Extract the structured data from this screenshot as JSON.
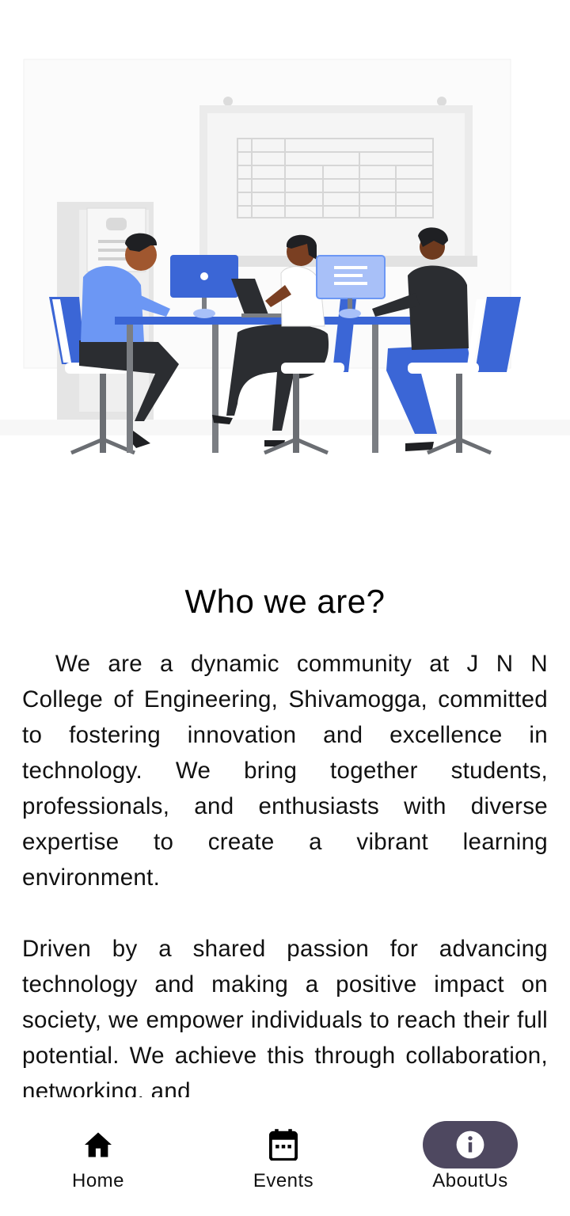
{
  "about": {
    "title": "Who we are?",
    "paragraph_1": "We are a dynamic community at J N N College of Engineering, Shivamogga, committed to fostering innovation and excellence in technology. We bring together students, professionals, and enthusiasts with diverse expertise to create a vibrant learning environment.",
    "paragraph_2": "Driven by a shared passion for advancing technology and making a positive impact on society, we empower individuals to reach their full potential. We achieve this through collaboration, networking, and"
  },
  "nav": {
    "items": [
      {
        "label": "Home",
        "icon": "home-icon"
      },
      {
        "label": "Events",
        "icon": "calendar-icon"
      },
      {
        "label": "AboutUs",
        "icon": "info-icon"
      }
    ],
    "active": "AboutUs"
  },
  "colors": {
    "accent_blue": "#3b66d6",
    "active_pill": "#4e4860",
    "text": "#111111"
  }
}
